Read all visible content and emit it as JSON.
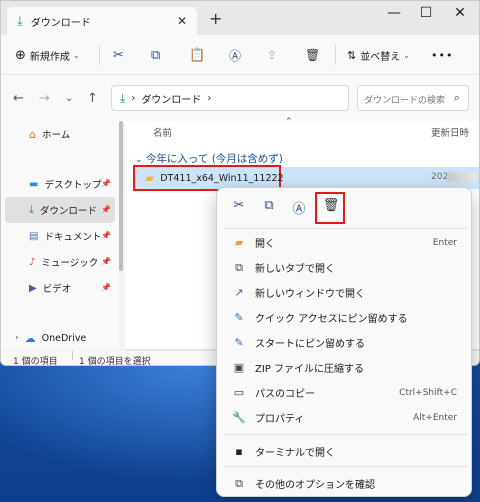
{
  "window": {
    "tab_title": "ダウンロード",
    "tab_close": "✕",
    "new_tab": "+",
    "minimize": "—",
    "maximize": "☐",
    "close": "✕"
  },
  "toolbar": {
    "new_label": "新規作成",
    "sort_label": "並べ替え",
    "more": "•••"
  },
  "address": {
    "path_segment": "ダウンロード",
    "separator": "›",
    "search_placeholder": "ダウンロードの検索"
  },
  "sidebar": {
    "items": [
      {
        "label": "ホーム",
        "icon": "home-icon"
      },
      {
        "label": "デスクトップ",
        "icon": "desktop-icon",
        "pinned": true
      },
      {
        "label": "ダウンロード",
        "icon": "download-icon",
        "pinned": true,
        "selected": true
      },
      {
        "label": "ドキュメント",
        "icon": "document-icon",
        "pinned": true
      },
      {
        "label": "ミュージック",
        "icon": "music-icon",
        "pinned": true
      },
      {
        "label": "ビデオ",
        "icon": "video-icon",
        "pinned": true
      },
      {
        "label": "OneDrive",
        "icon": "onedrive-icon"
      }
    ]
  },
  "content": {
    "col_name": "名前",
    "col_date": "更新日時",
    "group_header": "今年に入って (今月は含めず)",
    "file_name": "DT411_x64_Win11_11222",
    "file_date_prefix": "202"
  },
  "status": {
    "count": "1 個の項目",
    "selected": "1 個の項目を選択"
  },
  "context_menu": {
    "icons": [
      "cut-icon",
      "copy-icon",
      "rename-icon",
      "delete-icon"
    ],
    "items": [
      {
        "label": "開く",
        "shortcut": "Enter",
        "icon": "folder-open-icon"
      },
      {
        "label": "新しいタブで開く",
        "shortcut": "",
        "icon": "new-tab-icon"
      },
      {
        "label": "新しいウィンドウで開く",
        "shortcut": "",
        "icon": "new-window-icon"
      },
      {
        "label": "クイック アクセスにピン留めする",
        "shortcut": "",
        "icon": "pin-icon"
      },
      {
        "label": "スタートにピン留めする",
        "shortcut": "",
        "icon": "pin-icon"
      },
      {
        "label": "ZIP ファイルに圧縮する",
        "shortcut": "",
        "icon": "zip-icon"
      },
      {
        "label": "パスのコピー",
        "shortcut": "Ctrl+Shift+C",
        "icon": "copy-path-icon"
      },
      {
        "label": "プロパティ",
        "shortcut": "Alt+Enter",
        "icon": "wrench-icon"
      },
      {
        "label": "ターミナルで開く",
        "shortcut": "",
        "icon": "terminal-icon"
      },
      {
        "label": "その他のオプションを確認",
        "shortcut": "",
        "icon": "more-options-icon"
      }
    ]
  }
}
